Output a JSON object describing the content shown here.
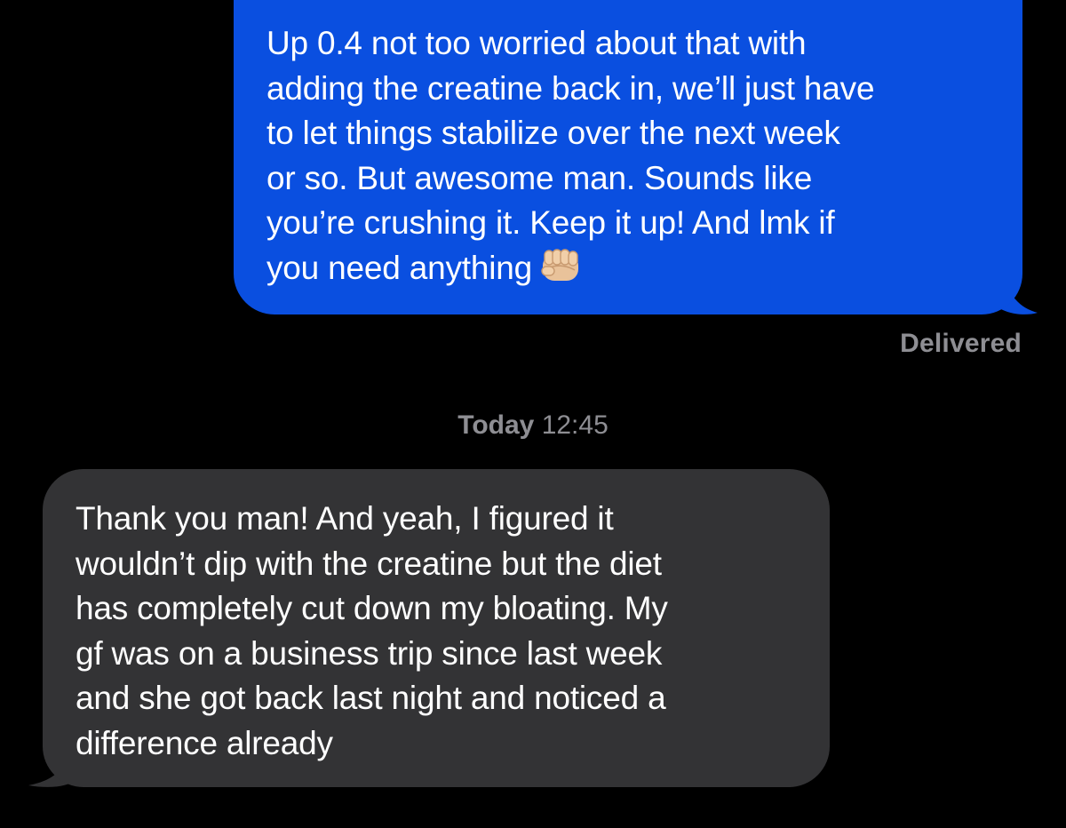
{
  "messages": [
    {
      "direction": "outgoing",
      "text": "Up 0.4 not too worried about that with\nadding the creatine back in, we’ll just have\nto let things stabilize over the next week\nor so. But awesome man. Sounds like\nyou’re crushing it. Keep it up! And lmk if\nyou need anything",
      "emoji": "fist-bump-icon",
      "status": "Delivered"
    },
    {
      "direction": "incoming",
      "text": "Thank you man! And yeah, I figured it\nwouldn’t dip with the creatine but the diet\nhas completely cut down my bloating. My\ngf was on a business trip since last week\nand she got back last night and noticed a\ndifference already"
    }
  ],
  "timestamp": {
    "day": "Today",
    "time": "12:45"
  },
  "colors": {
    "background": "#000000",
    "outgoing_bubble": "#0A4FE0",
    "incoming_bubble": "#333335",
    "meta_text": "#8e8e93"
  }
}
